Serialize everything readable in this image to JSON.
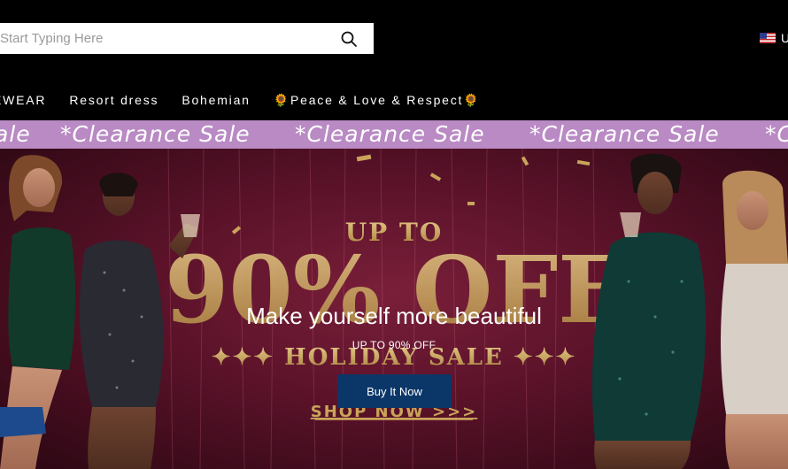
{
  "header": {
    "search": {
      "placeholder": "Start Typing Here"
    },
    "locale": {
      "flag_icon": "us-flag-icon",
      "label": "U"
    }
  },
  "nav": {
    "items": [
      {
        "label": "EWEAR"
      },
      {
        "label": "Resort dress"
      },
      {
        "label": "Bohemian"
      },
      {
        "label": "🌻Peace & Love & Respect🌻"
      }
    ]
  },
  "ticker": {
    "items": [
      "ale",
      "*Clearance Sale",
      "*Clearance Sale",
      "*Clearance Sale",
      "*C"
    ]
  },
  "hero": {
    "banner_text": {
      "up_to": "UP TO",
      "percent": "90% OFF",
      "holiday": "✦✦✦ HOLIDAY SALE ✦✦✦",
      "shop_now": "SHOP NOW >>>"
    },
    "headline": "Make yourself more beautiful",
    "subheadline": "UP TO 90% OFF",
    "cta_label": "Buy It Now"
  },
  "colors": {
    "ticker_bg": "#b98ac4",
    "cta_bg": "#0b3668",
    "gold": "#c9a45a",
    "hero_bg": "#5a1229"
  }
}
